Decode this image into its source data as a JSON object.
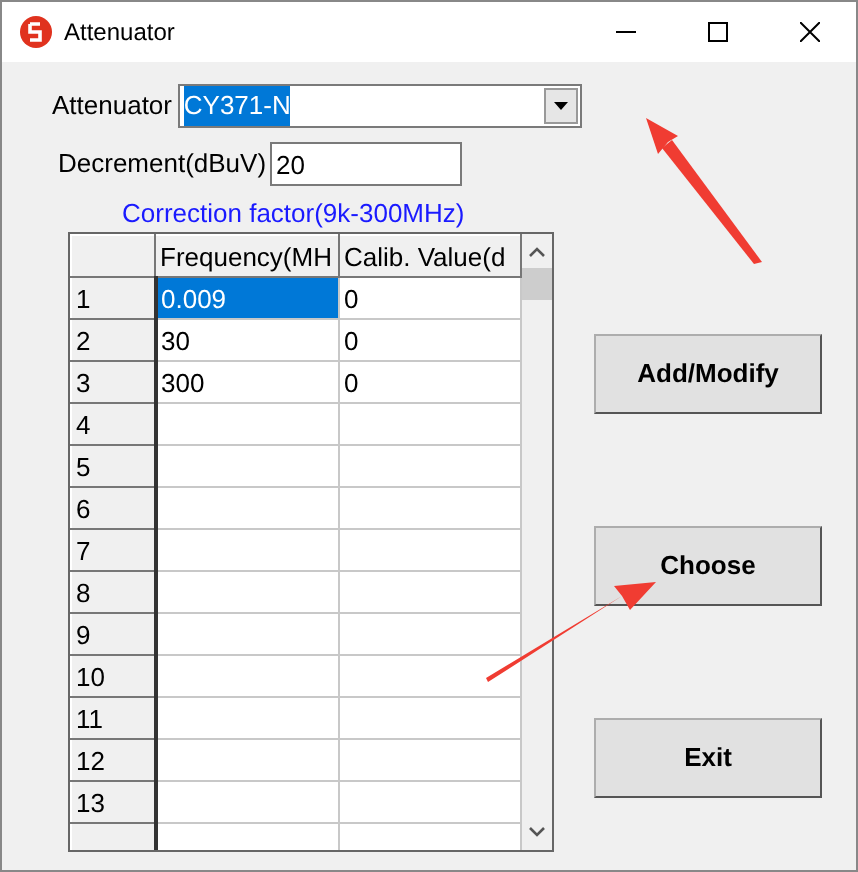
{
  "window": {
    "title": "Attenuator"
  },
  "attenuator": {
    "label": "Attenuator",
    "value": "CY371-N",
    "highlighted": true
  },
  "decrement": {
    "label": "Decrement(dBuV)",
    "value": "20"
  },
  "correction_title": "Correction factor(9k-300MHz)",
  "table": {
    "columns": [
      "Frequency(MH",
      "Calib. Value(d"
    ],
    "rows": [
      {
        "number": "1",
        "cells": [
          {
            "text": "0.009",
            "selected": true
          },
          {
            "text": "0",
            "selected": false
          }
        ]
      },
      {
        "number": "2",
        "cells": [
          {
            "text": "30",
            "selected": false
          },
          {
            "text": "0",
            "selected": false
          }
        ]
      },
      {
        "number": "3",
        "cells": [
          {
            "text": "300",
            "selected": false
          },
          {
            "text": "0",
            "selected": false
          }
        ]
      },
      {
        "number": "4"
      },
      {
        "number": "5"
      },
      {
        "number": "6"
      },
      {
        "number": "7"
      },
      {
        "number": "8"
      },
      {
        "number": "9"
      },
      {
        "number": "10"
      },
      {
        "number": "11"
      },
      {
        "number": "12"
      },
      {
        "number": "13"
      }
    ]
  },
  "buttons": [
    "Add/Modify",
    "Choose",
    "Exit"
  ]
}
